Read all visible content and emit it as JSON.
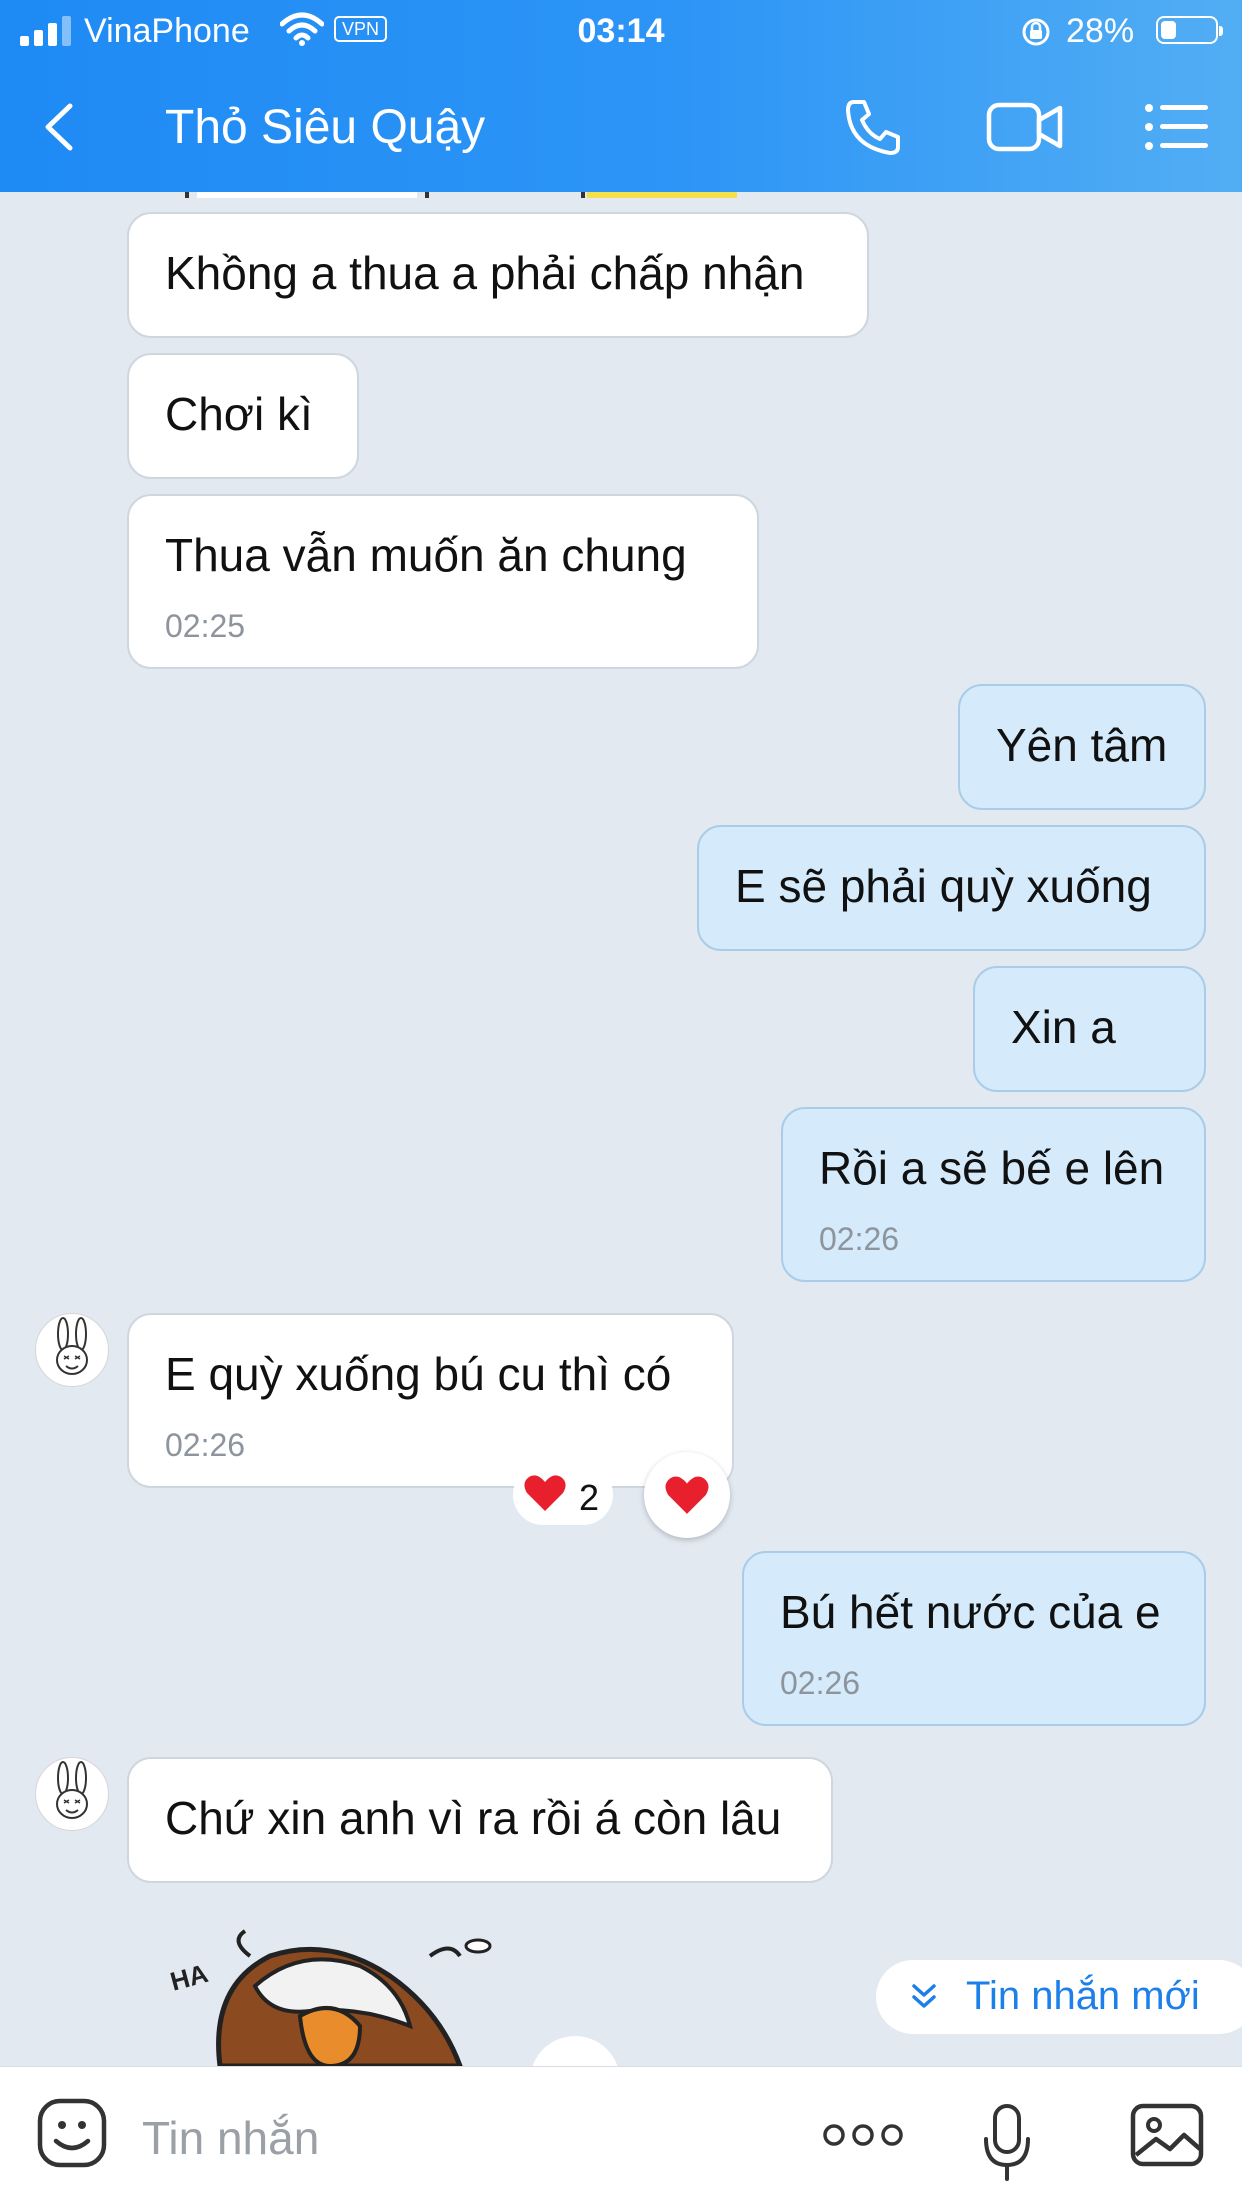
{
  "status_bar": {
    "carrier": "VinaPhone",
    "vpn": "VPN",
    "time": "03:14",
    "battery_percent": "28%",
    "battery_level": 0.28
  },
  "header": {
    "title": "Thỏ Siêu Quậy",
    "icons": [
      "back-icon",
      "phone-icon",
      "video-call-icon",
      "menu-icon"
    ]
  },
  "messages": [
    {
      "side": "in",
      "text": "Khồng a thua a phải chấp nhận",
      "time": ""
    },
    {
      "side": "in",
      "text": "Chơi kì",
      "time": ""
    },
    {
      "side": "in",
      "text": "Thua vẫn muốn ăn chung",
      "time": "02:25"
    },
    {
      "side": "out",
      "text": "Yên tâm",
      "time": ""
    },
    {
      "side": "out",
      "text": "E sẽ phải quỳ xuống",
      "time": ""
    },
    {
      "side": "out",
      "text": "Xin a",
      "time": ""
    },
    {
      "side": "out",
      "text": "Rồi a sẽ bế e lên",
      "time": "02:26"
    },
    {
      "side": "in",
      "text": "E quỳ xuống bú cu thì có",
      "time": "02:26",
      "reaction": {
        "emoji": "heart",
        "count": "2"
      }
    },
    {
      "side": "out",
      "text": "Bú hết nước của e",
      "time": "02:26"
    },
    {
      "side": "in",
      "text": "Chứ xin anh vì ra rồi á còn lâu",
      "time": ""
    }
  ],
  "new_messages_button": "Tin nhắn mới",
  "composer": {
    "placeholder": "Tin nhắn",
    "icons": [
      "emoji-icon",
      "more-icon",
      "microphone-icon",
      "image-icon"
    ]
  },
  "colors": {
    "header": "#2d95f6",
    "incoming_bubble": "#ffffff",
    "outgoing_bubble": "#d5ebfb",
    "background": "#e2e9f1",
    "accent": "#1d7fe8",
    "heart": "#e8202e"
  }
}
